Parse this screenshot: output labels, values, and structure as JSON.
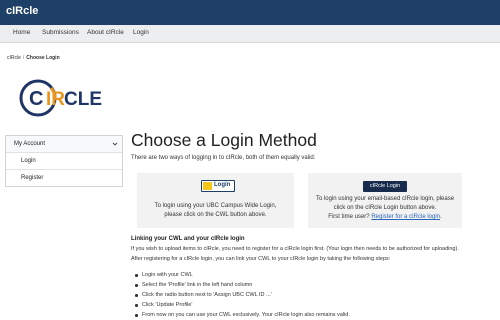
{
  "app": {
    "title": "cIRcle"
  },
  "nav": {
    "items": [
      "Home",
      "Submissions",
      "About cIRcle",
      "Login"
    ]
  },
  "breadcrumb": {
    "root": "cIRcle",
    "separator": "/",
    "current": "Choose Login"
  },
  "logo": {
    "text_c": "C",
    "text_ir": "IR",
    "text_cle": "CLE"
  },
  "sidebar": {
    "header": "My Account",
    "items": [
      "Login",
      "Register"
    ]
  },
  "main": {
    "title": "Choose a Login Method",
    "intro": "There are two ways of logging in to cIRcle, both of them equally valid:",
    "cwl_panel": {
      "button_label": "Login",
      "text_line1": "To login using your UBC Campus Wide Login,",
      "text_line2": "please click on the CWL button above."
    },
    "circle_panel": {
      "button_label": "cIRcle Login",
      "text_line1": "To login using your email-based cIRcle login, please",
      "text_line2": "click on the cIRcle Login button above.",
      "text_line3_prefix": "First time user?",
      "text_line3_link": "Register for a cIRcle login",
      "text_line3_suffix": "."
    },
    "section_heading": "Linking your CWL and your cIRcle login",
    "para1": "If you wish to upload items to cIRcle, you need to register for a cIRcle login first. (Your login then needs to be authorized for uploading).",
    "para2": "After registering for a cIRcle login, you can link your CWL to your cIRcle login by taking the following steps:",
    "steps": [
      "Login with your CWL",
      "Select the 'Profile' link in the left hand column",
      "Click the radio button next to 'Assign UBC CWL ID ...'",
      "Click 'Update Profile'",
      "From now on you can use your CWL exclusively. Your cIRcle login also remains valid."
    ]
  },
  "colors": {
    "brand": "#1e3f66",
    "logo_orange": "#e8961e",
    "logo_navy": "#1e3566",
    "link": "#2a66b8"
  },
  "icons": {
    "sidebar_header": "chevron-down-icon",
    "cwl_badge": "ubc-crest-icon"
  }
}
